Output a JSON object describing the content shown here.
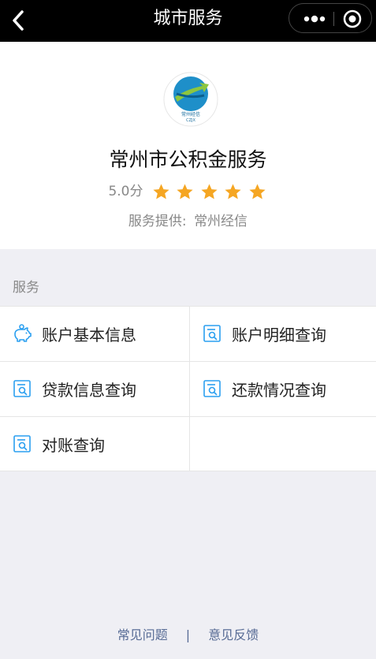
{
  "navbar": {
    "title": "城市服务"
  },
  "app": {
    "name": "常州市公积金服务",
    "logo_text": "常州经信",
    "logo_sub": "CZJX",
    "rating": "5.0分",
    "rating_value": 5,
    "provider_label": "服务提供:",
    "provider_name": "常州经信",
    "accent": "#f5a623"
  },
  "services": {
    "section_title": "服务",
    "items": [
      {
        "label": "账户基本信息",
        "icon": "piggy-bank-icon"
      },
      {
        "label": "账户明细查询",
        "icon": "document-search-icon"
      },
      {
        "label": "贷款信息查询",
        "icon": "document-search-icon"
      },
      {
        "label": "还款情况查询",
        "icon": "document-search-icon"
      },
      {
        "label": "对账查询",
        "icon": "document-search-icon"
      }
    ]
  },
  "footer": {
    "faq": "常见问题",
    "separator": "|",
    "feedback": "意见反馈"
  }
}
